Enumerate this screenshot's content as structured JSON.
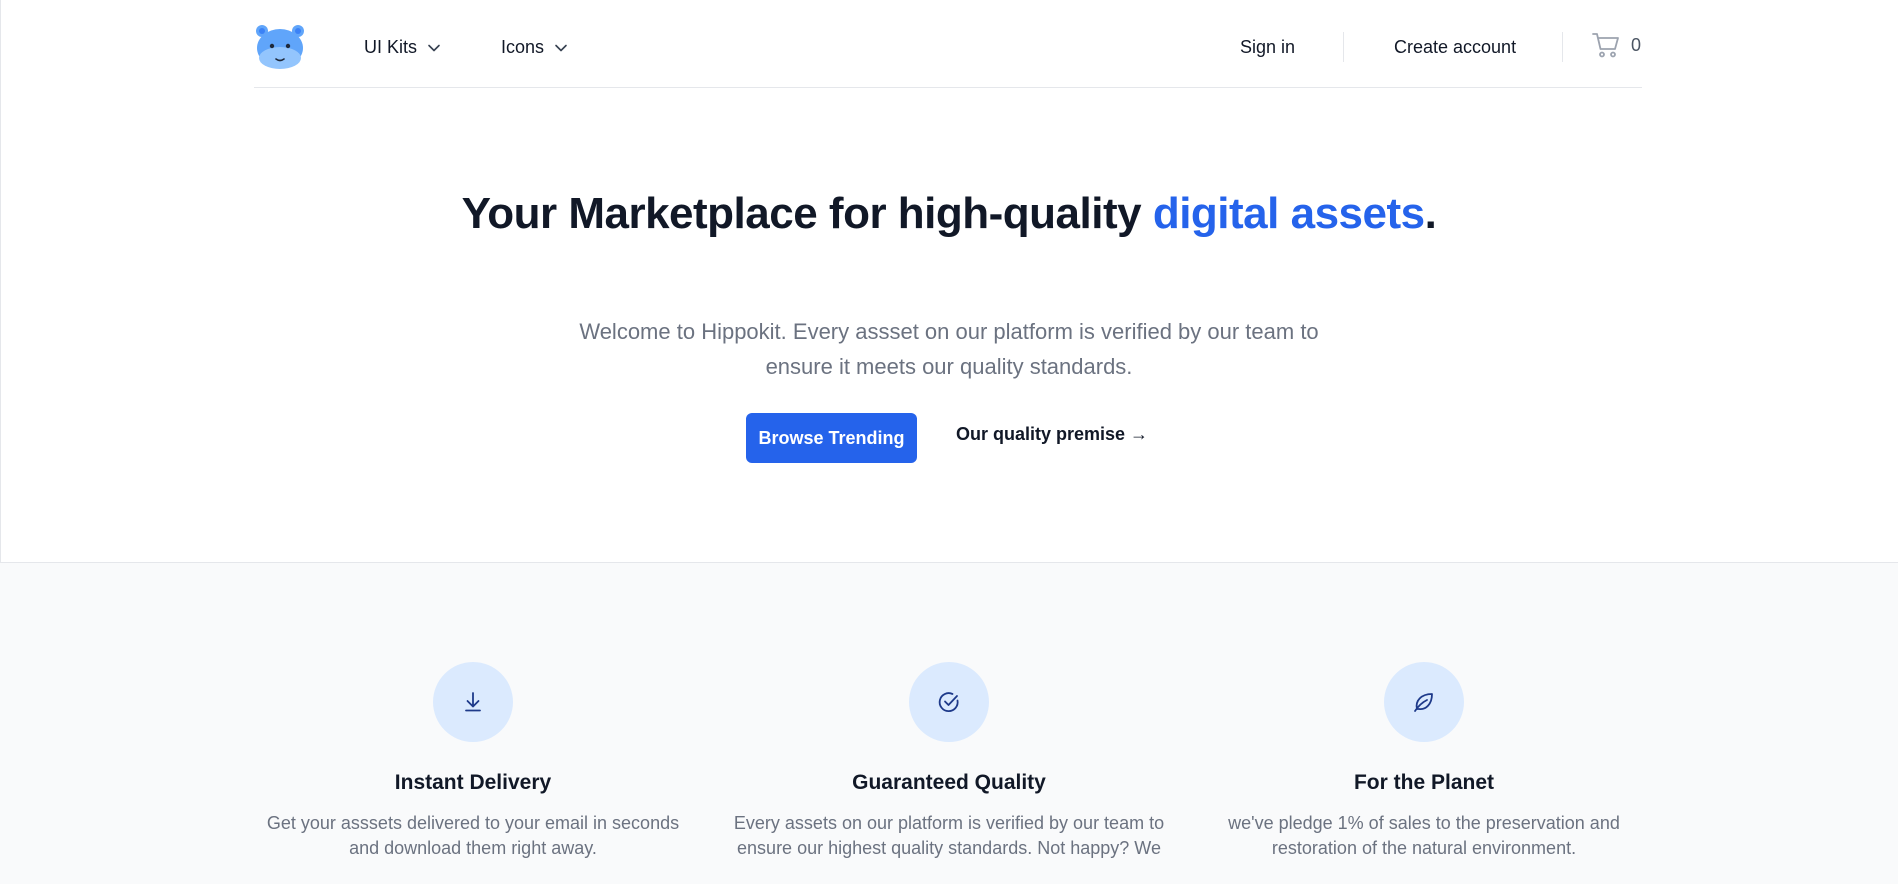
{
  "nav": {
    "logo": "hippo-logo",
    "menu": [
      {
        "label": "UI Kits",
        "icon": "chevron-down-icon"
      },
      {
        "label": "Icons",
        "icon": "chevron-down-icon"
      }
    ],
    "sign_in": "Sign in",
    "create_account": "Create account",
    "cart": {
      "icon": "shopping-cart-icon",
      "count": "0"
    }
  },
  "hero": {
    "title_main": "Your Marketplace for high-quality ",
    "title_accent": "digital assets",
    "title_end": ".",
    "subtitle": "Welcome to Hippokit. Every assset on our platform is verified by our team to ensure it meets our quality standards.",
    "primary_button": "Browse Trending",
    "secondary_link": "Our quality premise →"
  },
  "features": [
    {
      "icon": "download-icon",
      "title": "Instant Delivery",
      "description": "Get your asssets delivered to your email in seconds and download them right away."
    },
    {
      "icon": "check-circle-icon",
      "title": "Guaranteed Quality",
      "description": "Every assets on our platform is verified by our team to ensure our highest quality standards. Not happy? We"
    },
    {
      "icon": "leaf-icon",
      "title": "For the Planet",
      "description": "we've pledge 1% of sales to the preservation and restoration of the natural environment."
    }
  ],
  "colors": {
    "accent": "#2563eb",
    "icon_bg": "#dbeafe",
    "icon_stroke": "#1e3a8a",
    "section_bg": "#f9fafb",
    "text_muted": "#6b7280"
  }
}
